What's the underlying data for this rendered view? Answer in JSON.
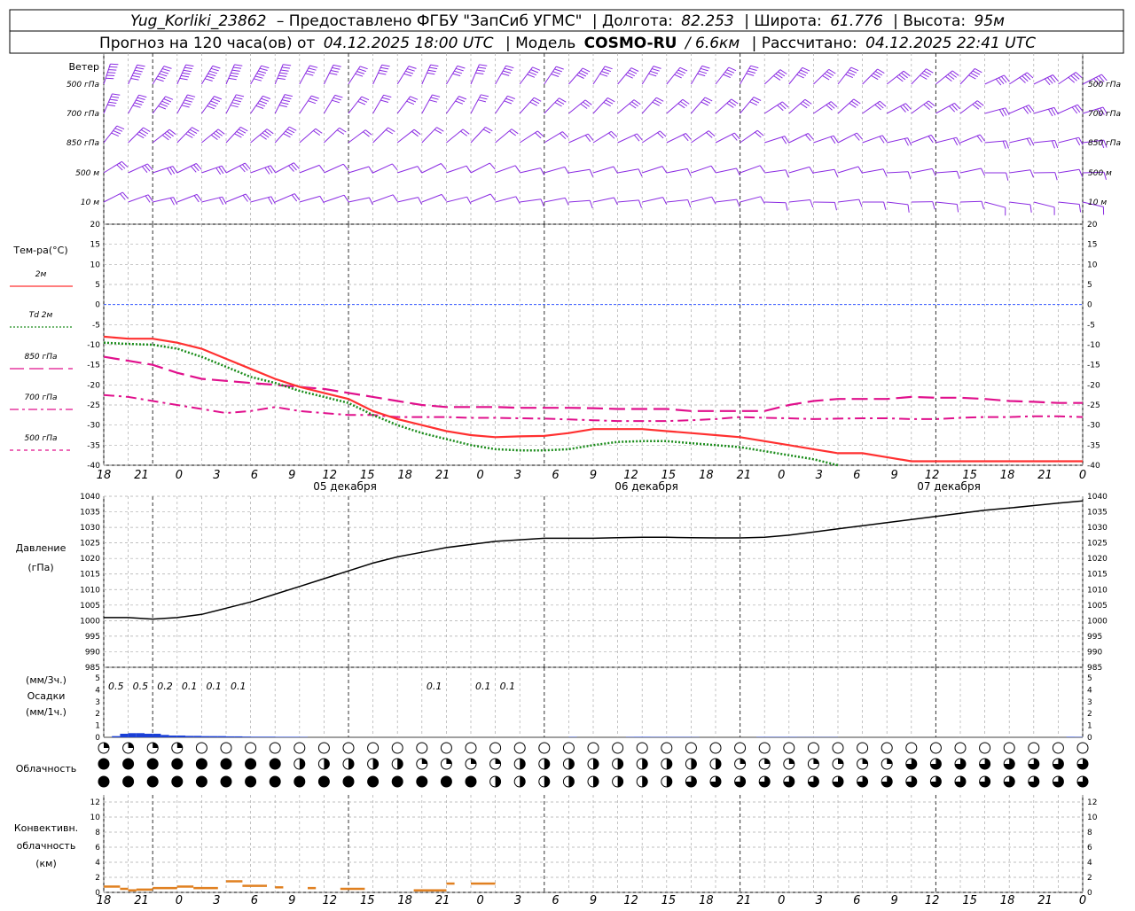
{
  "header": {
    "line1": {
      "station": "Yug_Korliki_23862",
      "provider": "– Предоставлено ФГБУ \"ЗапСиб УГМС\"",
      "lon_label": "| Долгота:",
      "lon": "82.253",
      "lat_label": "| Широта:",
      "lat": "61.776",
      "alt_label": "| Высота:",
      "alt": "95м"
    },
    "line2": {
      "forecast_label": "Прогноз на 120 часа(ов) от",
      "forecast_time": "04.12.2025 18:00 UTC",
      "model_label": "| Модель",
      "model": "COSMO-RU",
      "model_res": "/ 6.6км",
      "calc_label": "| Рассчитано:",
      "calc_time": "04.12.2025 22:41 UTC"
    }
  },
  "axes": {
    "hour_ticks": [
      "18",
      "21",
      "0",
      "3",
      "6",
      "9",
      "12",
      "15",
      "18",
      "21",
      "0",
      "3",
      "6",
      "9",
      "12",
      "15",
      "18",
      "21",
      "0",
      "3",
      "6",
      "9",
      "12",
      "15",
      "18",
      "21",
      "0"
    ],
    "day_labels": [
      "05 декабря",
      "06 декабря",
      "07 декабря"
    ]
  },
  "wind_panel": {
    "title": "Ветер",
    "levels": [
      "500 гПа",
      "700 гПа",
      "850 гПа",
      "500 м",
      "10  м"
    ],
    "color": "#8a2be2"
  },
  "temperature_panel": {
    "title": "Тем-ра(°С)",
    "legend": [
      {
        "label": "2м",
        "color": "#ff3030",
        "style": "solid"
      },
      {
        "label": "Td  2м",
        "color": "#1a8c1a",
        "style": "dotted"
      },
      {
        "label": "850 гПа",
        "color": "#e0108c",
        "style": "long-dash"
      },
      {
        "label": "700 гПа",
        "color": "#e0108c",
        "style": "dash-dot"
      },
      {
        "label": "500 гПа",
        "color": "#e0108c",
        "style": "short-dash"
      }
    ],
    "y_ticks": [
      "20",
      "15",
      "10",
      "5",
      "0",
      "-5",
      "-10",
      "-15",
      "-20",
      "-25",
      "-30",
      "-35",
      "-40"
    ]
  },
  "pressure_panel": {
    "title": "Давление",
    "unit": "(гПа)",
    "y_ticks": [
      "1040",
      "1035",
      "1030",
      "1025",
      "1020",
      "1015",
      "1010",
      "1005",
      "1000",
      "995",
      "990",
      "985"
    ]
  },
  "precip_panel": {
    "title_3h": "(мм/3ч.)",
    "title": "Осадки",
    "title_1h": "(мм/1ч.)",
    "y_ticks": [
      "5",
      "4",
      "3",
      "2",
      "1",
      "0"
    ],
    "labels": [
      {
        "hour": 1.5,
        "text": "0.5"
      },
      {
        "hour": 4.5,
        "text": "0.5"
      },
      {
        "hour": 7.5,
        "text": "0.2"
      },
      {
        "hour": 10.5,
        "text": "0.1"
      },
      {
        "hour": 13.5,
        "text": "0.1"
      },
      {
        "hour": 16.5,
        "text": "0.1"
      },
      {
        "hour": 40.5,
        "text": "0.1"
      },
      {
        "hour": 46.5,
        "text": "0.1"
      },
      {
        "hour": 49.5,
        "text": "0.1"
      }
    ]
  },
  "cloud_panel": {
    "title": "Облачность"
  },
  "convective_panel": {
    "title_1": "Конвективн.",
    "title_2": "облачность",
    "unit": "(км)",
    "y_ticks": [
      "12",
      "10",
      "8",
      "6",
      "4",
      "2",
      "0"
    ]
  },
  "chart_data": [
    {
      "type": "line",
      "title": "Тем-ра(°С)",
      "x_hours_from_start": [
        0,
        3,
        6,
        9,
        12,
        15,
        18,
        21,
        24,
        27,
        30,
        33,
        36,
        39,
        42,
        45,
        48,
        51,
        54,
        57,
        60,
        63,
        66,
        69,
        72,
        75,
        78,
        81,
        84,
        87,
        90,
        93,
        96,
        99,
        102,
        105,
        108,
        111,
        114,
        117,
        120
      ],
      "ylim": [
        -40,
        20
      ],
      "series": [
        {
          "name": "2м",
          "values": [
            -8,
            -8.5,
            -8.5,
            -9.5,
            -11,
            -13.5,
            -16,
            -18.5,
            -20.5,
            -22,
            -23.5,
            -26.5,
            -28.5,
            -30,
            -31.5,
            -32.5,
            -33,
            -32.8,
            -32.7,
            -32,
            -31,
            -31,
            -31,
            -31.5,
            -32,
            -32.5,
            -33,
            -34,
            -35,
            -36,
            -37,
            -37,
            -38,
            -39,
            -39,
            -39,
            -39,
            -39,
            -39,
            -39,
            -39
          ]
        },
        {
          "name": "Td  2м",
          "values": [
            -9.5,
            -9.8,
            -10,
            -11,
            -13,
            -15.5,
            -18,
            -19.5,
            -21.5,
            -23,
            -24.5,
            -27.5,
            -30,
            -32,
            -33.5,
            -35,
            -36,
            -36.3,
            -36.3,
            -36,
            -35,
            -34.2,
            -34,
            -34,
            -34.5,
            -35,
            -35.5,
            -36.5,
            -37.5,
            -38.5,
            -40,
            null,
            null,
            null,
            null,
            null,
            null,
            null,
            null,
            null,
            null
          ]
        },
        {
          "name": "850 гПа",
          "values": [
            -13,
            -14,
            -15,
            -17,
            -18.5,
            -19,
            -19.5,
            -20,
            -20.5,
            -21,
            -22,
            -23,
            -24,
            -25,
            -25.5,
            -25.5,
            -25.5,
            -25.7,
            -25.7,
            -25.7,
            -25.8,
            -26,
            -26,
            -26,
            -26.5,
            -26.5,
            -26.5,
            -26.5,
            -25,
            -24,
            -23.5,
            -23.5,
            -23.5,
            -23,
            -23.2,
            -23.2,
            -23.5,
            -24,
            -24.2,
            -24.5,
            -24.5
          ]
        },
        {
          "name": "700 гПа",
          "values": [
            -22.5,
            -23,
            -24,
            -25,
            -26,
            -27,
            -26.5,
            -25.5,
            -26.5,
            -27,
            -27.5,
            -27.5,
            -28,
            -28,
            -28,
            -28.2,
            -28.2,
            -28.3,
            -28.4,
            -28.6,
            -28.8,
            -29,
            -29,
            -29,
            -28.8,
            -28.5,
            -28,
            -28.2,
            -28.3,
            -28.5,
            -28.4,
            -28.3,
            -28.3,
            -28.5,
            -28.5,
            -28.2,
            -28,
            -28,
            -27.8,
            -27.8,
            -28
          ]
        },
        {
          "name": "500 гПа",
          "values": []
        }
      ]
    },
    {
      "type": "line",
      "title": "Давление",
      "x_hours_from_start": [
        0,
        3,
        6,
        9,
        12,
        15,
        18,
        21,
        24,
        27,
        30,
        33,
        36,
        39,
        42,
        45,
        48,
        51,
        54,
        57,
        60,
        63,
        66,
        69,
        72,
        75,
        78,
        81,
        84,
        87,
        90,
        93,
        96,
        99,
        102,
        105,
        108,
        111,
        114,
        117,
        120
      ],
      "ylim": [
        985,
        1040
      ],
      "series": [
        {
          "name": "Давление",
          "values": [
            1001,
            1001,
            1000.5,
            1001,
            1002,
            1004,
            1006,
            1008.5,
            1011,
            1013.5,
            1016,
            1018.5,
            1020.5,
            1022,
            1023.5,
            1024.5,
            1025.5,
            1026,
            1026.5,
            1026.5,
            1026.5,
            1026.7,
            1026.8,
            1026.8,
            1026.7,
            1026.6,
            1026.6,
            1026.8,
            1027.5,
            1028.5,
            1029.5,
            1030.5,
            1031.5,
            1032.5,
            1033.5,
            1034.5,
            1035.5,
            1036.2,
            1037,
            1037.8,
            1038.5
          ]
        }
      ]
    },
    {
      "type": "bar",
      "title": "Осадки",
      "x_hours_from_start": [
        1,
        2,
        3,
        4,
        5,
        6,
        7,
        8,
        9,
        10,
        11,
        12,
        13,
        14,
        15,
        16,
        17,
        18,
        19,
        20,
        21,
        22,
        23,
        24,
        25,
        26,
        27,
        28,
        29,
        30,
        31,
        32,
        33,
        34,
        35,
        36,
        37,
        38,
        39,
        40,
        41,
        42,
        43,
        44,
        45,
        46,
        47,
        48,
        49,
        50,
        51,
        52,
        53,
        54,
        55,
        56,
        57,
        58,
        59,
        60,
        61,
        62,
        63,
        64,
        65,
        66,
        67,
        68,
        69,
        70,
        71,
        72,
        73,
        74,
        75,
        76,
        77,
        78,
        79,
        80,
        81,
        82,
        83,
        84,
        85,
        86,
        87,
        88,
        89,
        90,
        91,
        92,
        93,
        94,
        95,
        96,
        97,
        98,
        99,
        100,
        101,
        102,
        103,
        104,
        105,
        106,
        107,
        108,
        109,
        110,
        111,
        112,
        113,
        114,
        115,
        116,
        117,
        118,
        119,
        120
      ],
      "ylim": [
        0,
        5
      ],
      "values": [
        0,
        0.1,
        0.3,
        0.35,
        0.35,
        0.3,
        0.3,
        0.2,
        0.15,
        0.15,
        0.12,
        0.12,
        0.1,
        0.1,
        0.1,
        0.08,
        0.08,
        0.06,
        0.05,
        0.05,
        0.05,
        0.04,
        0.04,
        0.04,
        0.03,
        0,
        0,
        0,
        0,
        0,
        0,
        0,
        0,
        0,
        0,
        0,
        0,
        0,
        0,
        0,
        0,
        0,
        0,
        0,
        0,
        0,
        0,
        0,
        0,
        0,
        0,
        0,
        0,
        0,
        0,
        0,
        0,
        0.03,
        0,
        0,
        0,
        0,
        0,
        0,
        0.03,
        0.04,
        0.04,
        0.03,
        0.03,
        0.03,
        0.03,
        0.03,
        0.02,
        0,
        0,
        0,
        0,
        0,
        0,
        0,
        0.03,
        0.03,
        0.03,
        0.03,
        0.03,
        0.02,
        0.02,
        0.02,
        0.02,
        0.02,
        0,
        0,
        0,
        0,
        0,
        0,
        0,
        0,
        0,
        0,
        0,
        0,
        0,
        0,
        0,
        0,
        0,
        0,
        0,
        0,
        0,
        0,
        0,
        0,
        0,
        0,
        0,
        0,
        0.04,
        0.03,
        0,
        0,
        0,
        0,
        0,
        0,
        0,
        0,
        0.03,
        0.03,
        0,
        0,
        0,
        0,
        0,
        0,
        0,
        0,
        0,
        0,
        0,
        0,
        0,
        0,
        0,
        0
      ]
    },
    {
      "type": "bar",
      "title": "Конвективн. облачность",
      "segments_hours_km": [
        {
          "from": 0,
          "to": 2,
          "km": 0.8
        },
        {
          "from": 2,
          "to": 3,
          "km": 0.5
        },
        {
          "from": 3,
          "to": 4,
          "km": 0.3
        },
        {
          "from": 4,
          "to": 6,
          "km": 0.4
        },
        {
          "from": 6,
          "to": 9,
          "km": 0.6
        },
        {
          "from": 9,
          "to": 11,
          "km": 0.8
        },
        {
          "from": 11,
          "to": 14,
          "km": 0.6
        },
        {
          "from": 15,
          "to": 17,
          "km": 1.5
        },
        {
          "from": 17,
          "to": 20,
          "km": 0.9
        },
        {
          "from": 21,
          "to": 22,
          "km": 0.7
        },
        {
          "from": 25,
          "to": 26,
          "km": 0.6
        },
        {
          "from": 29,
          "to": 32,
          "km": 0.5
        },
        {
          "from": 38,
          "to": 42,
          "km": 0.3
        },
        {
          "from": 42,
          "to": 43,
          "km": 1.2
        },
        {
          "from": 45,
          "to": 48,
          "km": 1.2
        }
      ],
      "ylim": [
        0,
        12
      ]
    }
  ]
}
